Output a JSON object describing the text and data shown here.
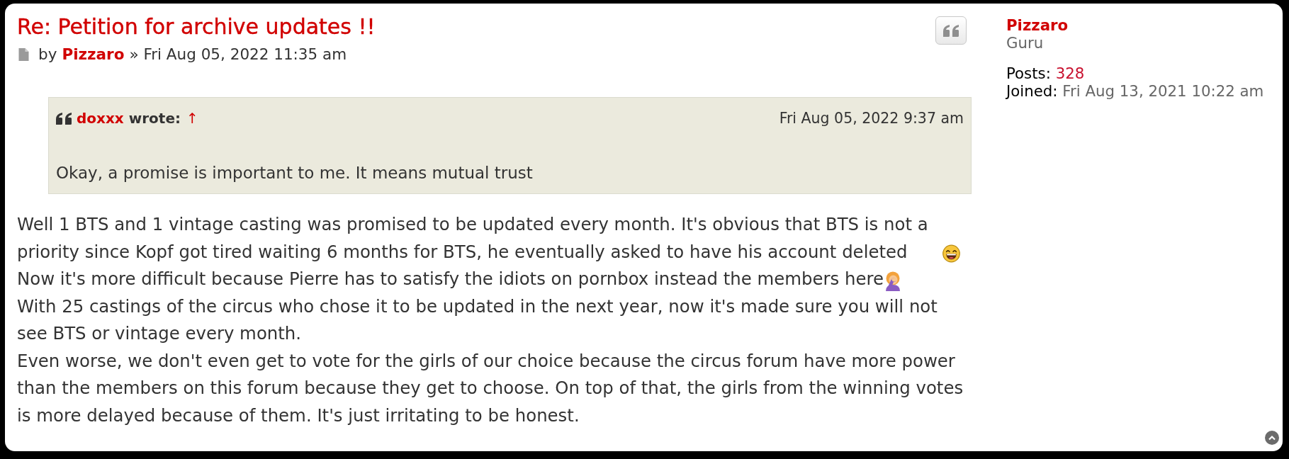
{
  "post": {
    "title": "Re: Petition for archive updates !!",
    "byline": {
      "prefix": "by",
      "author": "Pizzaro",
      "date": "» Fri Aug 05, 2022 11:35 am"
    },
    "quote": {
      "author": "doxxx",
      "verb": "wrote:",
      "jump_link": "↑",
      "date": "Fri Aug 05, 2022 9:37 am",
      "text": "Okay, a promise is important to me. It means mutual trust"
    },
    "body": [
      {
        "kind": "laughing",
        "text": "Well 1 BTS and 1 vintage casting was promised to be updated every month. It's obvious that BTS is not a priority since Kopf got tired waiting 6 months for BTS, he eventually asked to have his account deleted"
      },
      {
        "kind": "facepalm",
        "text": "Now it's more difficult because Pierre has to satisfy the idiots on pornbox instead the members here"
      },
      {
        "kind": "plain",
        "text": "With 25 castings of the circus who chose it to be updated in the next year, now it's made sure you will not see BTS or vintage every month."
      },
      {
        "kind": "plain",
        "text": "Even worse, we don't even get to vote for the girls of our choice because the circus forum have more power than the members on this forum because they get to choose. On top of that, the girls from the winning votes is more delayed because of them. It's just irritating to be honest."
      }
    ]
  },
  "profile": {
    "username": "Pizzaro",
    "rank": "Guru",
    "fields": [
      {
        "label": "Posts:",
        "value": "328",
        "kind": "link"
      },
      {
        "label": "Joined:",
        "value": "Fri Aug 13, 2021 10:22 am",
        "kind": "text"
      }
    ]
  }
}
